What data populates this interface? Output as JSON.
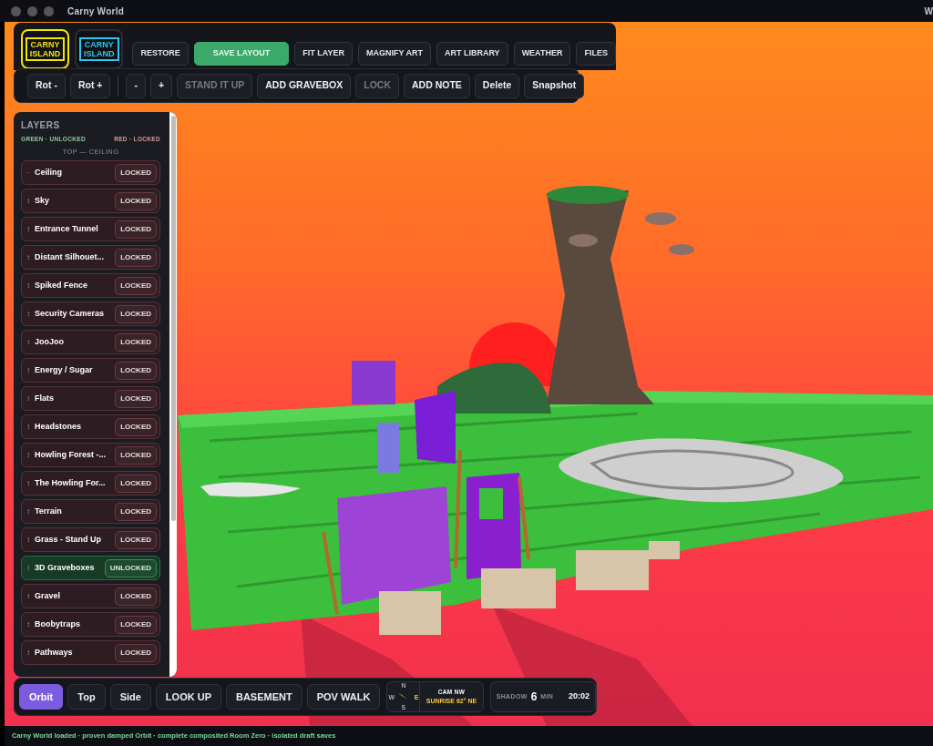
{
  "window": {
    "title": "Carny World",
    "edge_text": "W"
  },
  "logo_tabs": [
    {
      "line1": "CARNY",
      "line2": "ISLAND",
      "color": "#f5e400",
      "selected": true
    },
    {
      "line1": "CARNY",
      "line2": "ISLAND",
      "color": "#2ec5f0",
      "selected": false
    }
  ],
  "top_buttons": [
    {
      "label": "RESTORE",
      "primary": false
    },
    {
      "label": "SAVE LAYOUT",
      "primary": true
    },
    {
      "label": "FIT LAYER",
      "primary": false
    },
    {
      "label": "MAGNIFY ART",
      "primary": false
    },
    {
      "label": "ART LIBRARY",
      "primary": false
    },
    {
      "label": "WEATHER",
      "primary": false
    },
    {
      "label": "FILES",
      "primary": false
    }
  ],
  "edit_groups": [
    [
      {
        "label": "Rot -",
        "disabled": false
      },
      {
        "label": "Rot +",
        "disabled": false
      }
    ],
    [
      {
        "label": "-",
        "disabled": false
      },
      {
        "label": "+",
        "disabled": false
      },
      {
        "label": "STAND IT UP",
        "disabled": true
      },
      {
        "label": "ADD GRAVEBOX",
        "disabled": false
      },
      {
        "label": "LOCK",
        "disabled": true
      },
      {
        "label": "ADD NOTE",
        "disabled": false
      },
      {
        "label": "Delete",
        "disabled": false
      },
      {
        "label": "Snapshot",
        "disabled": false
      }
    ]
  ],
  "layers": {
    "title": "LAYERS",
    "legend_unlocked": "GREEN · UNLOCKED",
    "legend_locked": "RED · LOCKED",
    "top_label": "TOP — CEILING",
    "items": [
      {
        "handle": "·",
        "name": "Ceiling",
        "status": "LOCKED",
        "locked": true
      },
      {
        "handle": "↕",
        "name": "Sky",
        "status": "LOCKED",
        "locked": true
      },
      {
        "handle": "↕",
        "name": "Entrance Tunnel",
        "status": "LOCKED",
        "locked": true
      },
      {
        "handle": "↕",
        "name": "Distant Silhouet...",
        "status": "LOCKED",
        "locked": true
      },
      {
        "handle": "↕",
        "name": "Spiked Fence",
        "status": "LOCKED",
        "locked": true
      },
      {
        "handle": "↕",
        "name": "Security Cameras",
        "status": "LOCKED",
        "locked": true
      },
      {
        "handle": "↕",
        "name": "JooJoo",
        "status": "LOCKED",
        "locked": true
      },
      {
        "handle": "↕",
        "name": "Energy / Sugar",
        "status": "LOCKED",
        "locked": true
      },
      {
        "handle": "↕",
        "name": "Flats",
        "status": "LOCKED",
        "locked": true
      },
      {
        "handle": "↕",
        "name": "Headstones",
        "status": "LOCKED",
        "locked": true
      },
      {
        "handle": "↕",
        "name": "Howling Forest -...",
        "status": "LOCKED",
        "locked": true
      },
      {
        "handle": "↕",
        "name": "The Howling For...",
        "status": "LOCKED",
        "locked": true
      },
      {
        "handle": "↕",
        "name": "Terrain",
        "status": "LOCKED",
        "locked": true
      },
      {
        "handle": "↕",
        "name": "Grass - Stand Up",
        "status": "LOCKED",
        "locked": true
      },
      {
        "handle": "↕",
        "name": "3D Graveboxes",
        "status": "UNLOCKED",
        "locked": false
      },
      {
        "handle": "↕",
        "name": "Gravel",
        "status": "LOCKED",
        "locked": true
      },
      {
        "handle": "↕",
        "name": "Boobytraps",
        "status": "LOCKED",
        "locked": true
      },
      {
        "handle": "↕",
        "name": "Pathways",
        "status": "LOCKED",
        "locked": true
      }
    ]
  },
  "view_buttons": [
    {
      "label": "Orbit",
      "selected": true
    },
    {
      "label": "Top",
      "selected": false
    },
    {
      "label": "Side",
      "selected": false
    },
    {
      "label": "LOOK UP",
      "selected": false
    },
    {
      "label": "BASEMENT",
      "selected": false
    },
    {
      "label": "POV WALK",
      "selected": false
    }
  ],
  "compass": {
    "n": "N",
    "s": "S",
    "w": "W",
    "e": "E",
    "camera": "CAM NW",
    "sun": "SUNRISE 62° NE"
  },
  "shadow": {
    "label": "SHADOW",
    "value": "6",
    "unit": "MIN",
    "time": "20:02"
  },
  "status_bar": "Carny World loaded · proven damped Orbit · complete composited Room Zero · isolated draft saves"
}
